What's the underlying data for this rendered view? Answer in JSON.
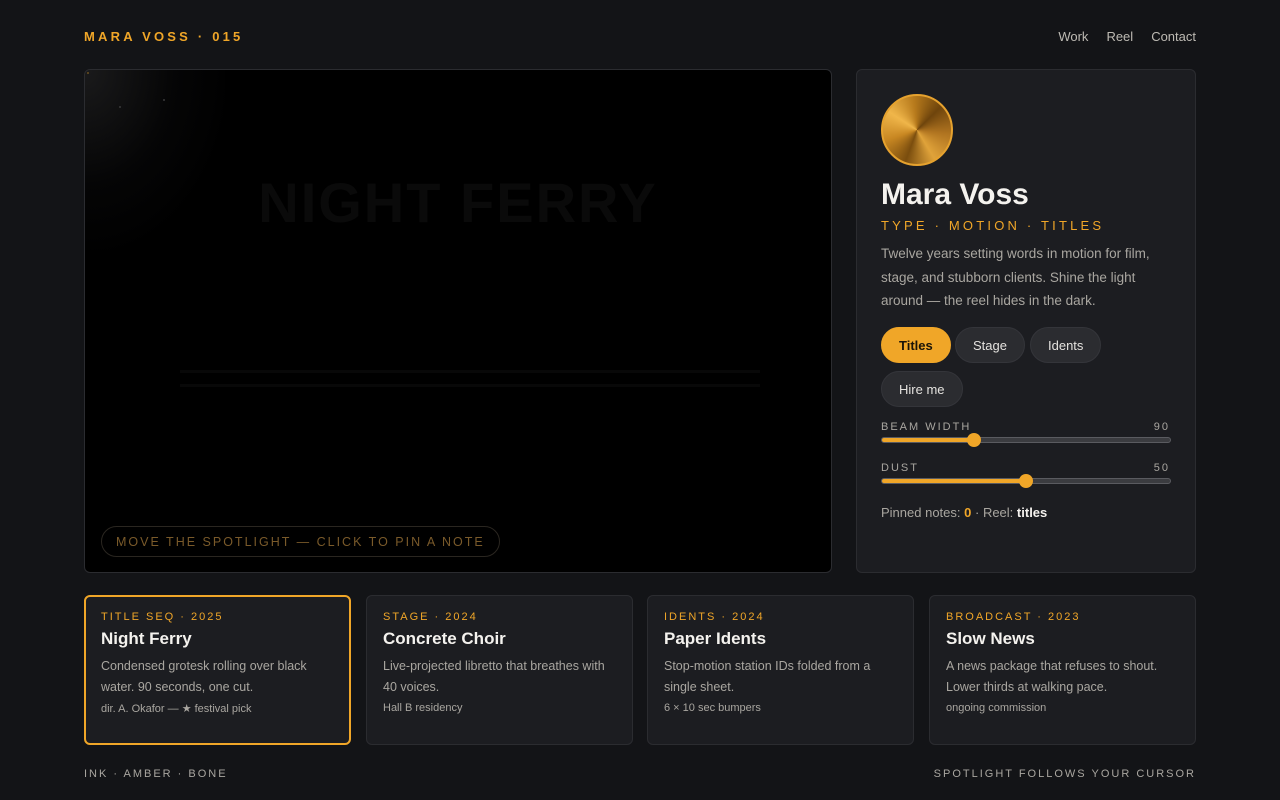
{
  "header": {
    "brand": "MARA VOSS · 015",
    "nav": [
      "Work",
      "Reel",
      "Contact"
    ]
  },
  "stage": {
    "hidden_title": "NIGHT FERRY",
    "hint": "MOVE THE SPOTLIGHT — CLICK TO PIN A NOTE"
  },
  "profile": {
    "name": "Mara Voss",
    "role": "TYPE · MOTION · TITLES",
    "bio": "Twelve years setting words in motion for film, stage, and stubborn clients. Shine the light around — the reel hides in the dark.",
    "chips": [
      "Titles",
      "Stage",
      "Idents",
      "Hire me"
    ],
    "active_chip": "Titles",
    "sliders": [
      {
        "label": "BEAM WIDTH",
        "value": "90",
        "fraction": 0.32
      },
      {
        "label": "DUST",
        "value": "50",
        "fraction": 0.5
      }
    ],
    "notes_label": "Pinned notes:",
    "notes_count": "0",
    "reel_label": "· Reel:",
    "reel_value": "titles"
  },
  "cards": [
    {
      "meta": "TITLE SEQ · 2025",
      "title": "Night Ferry",
      "desc": "Condensed grotesk rolling over black water. 90 seconds, one cut.",
      "foot": "dir. A. Okafor — ★ festival pick"
    },
    {
      "meta": "STAGE · 2024",
      "title": "Concrete Choir",
      "desc": "Live-projected libretto that breathes with 40 voices.",
      "foot": "Hall B residency"
    },
    {
      "meta": "IDENTS · 2024",
      "title": "Paper Idents",
      "desc": "Stop-motion station IDs folded from a single sheet.",
      "foot": "6 × 10 sec bumpers"
    },
    {
      "meta": "BROADCAST · 2023",
      "title": "Slow News",
      "desc": "A news package that refuses to shout. Lower thirds at walking pace.",
      "foot": "ongoing commission"
    }
  ],
  "footer": {
    "left": "INK · AMBER · BONE",
    "right": "SPOTLIGHT FOLLOWS YOUR CURSOR"
  },
  "colors": {
    "accent": "#f0a628",
    "background": "#131417",
    "panel": "#1c1d21"
  }
}
